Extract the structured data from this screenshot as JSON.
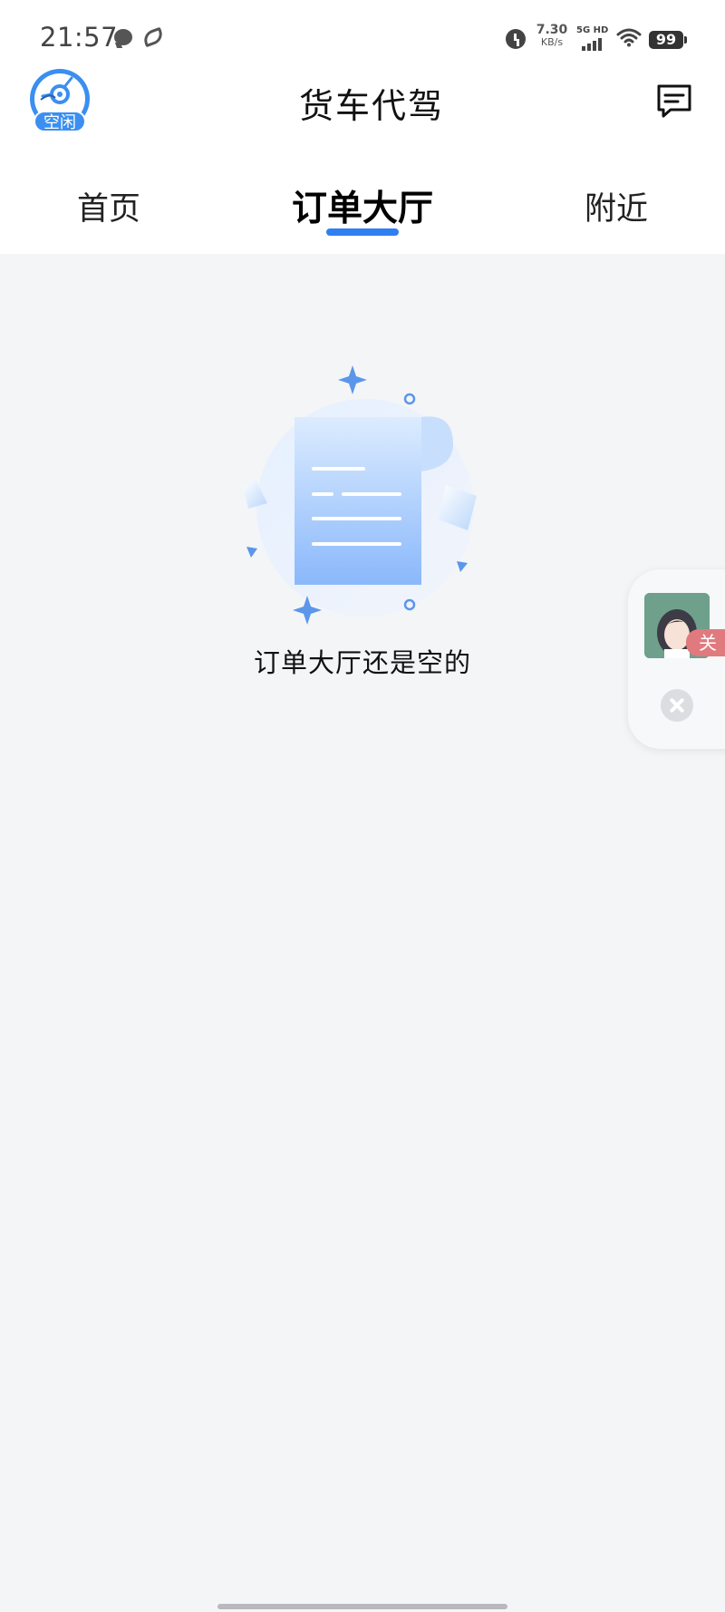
{
  "status_bar": {
    "time": "21:57",
    "net_speed_value": "7.30",
    "net_speed_unit": "KB/s",
    "network_label": "5G HD",
    "battery": "99"
  },
  "header": {
    "title": "货车代驾",
    "avatar_status": "空闲"
  },
  "tabs": [
    {
      "label": "首页",
      "active": false
    },
    {
      "label": "订单大厅",
      "active": true
    },
    {
      "label": "附近",
      "active": false
    }
  ],
  "empty_state": {
    "message": "订单大厅还是空的"
  },
  "floating_widget": {
    "tag": "关"
  },
  "colors": {
    "accent": "#2f7ff0",
    "background": "#f4f5f7",
    "badge": "#3a8ff0",
    "widget_tag": "#e07a7e"
  }
}
